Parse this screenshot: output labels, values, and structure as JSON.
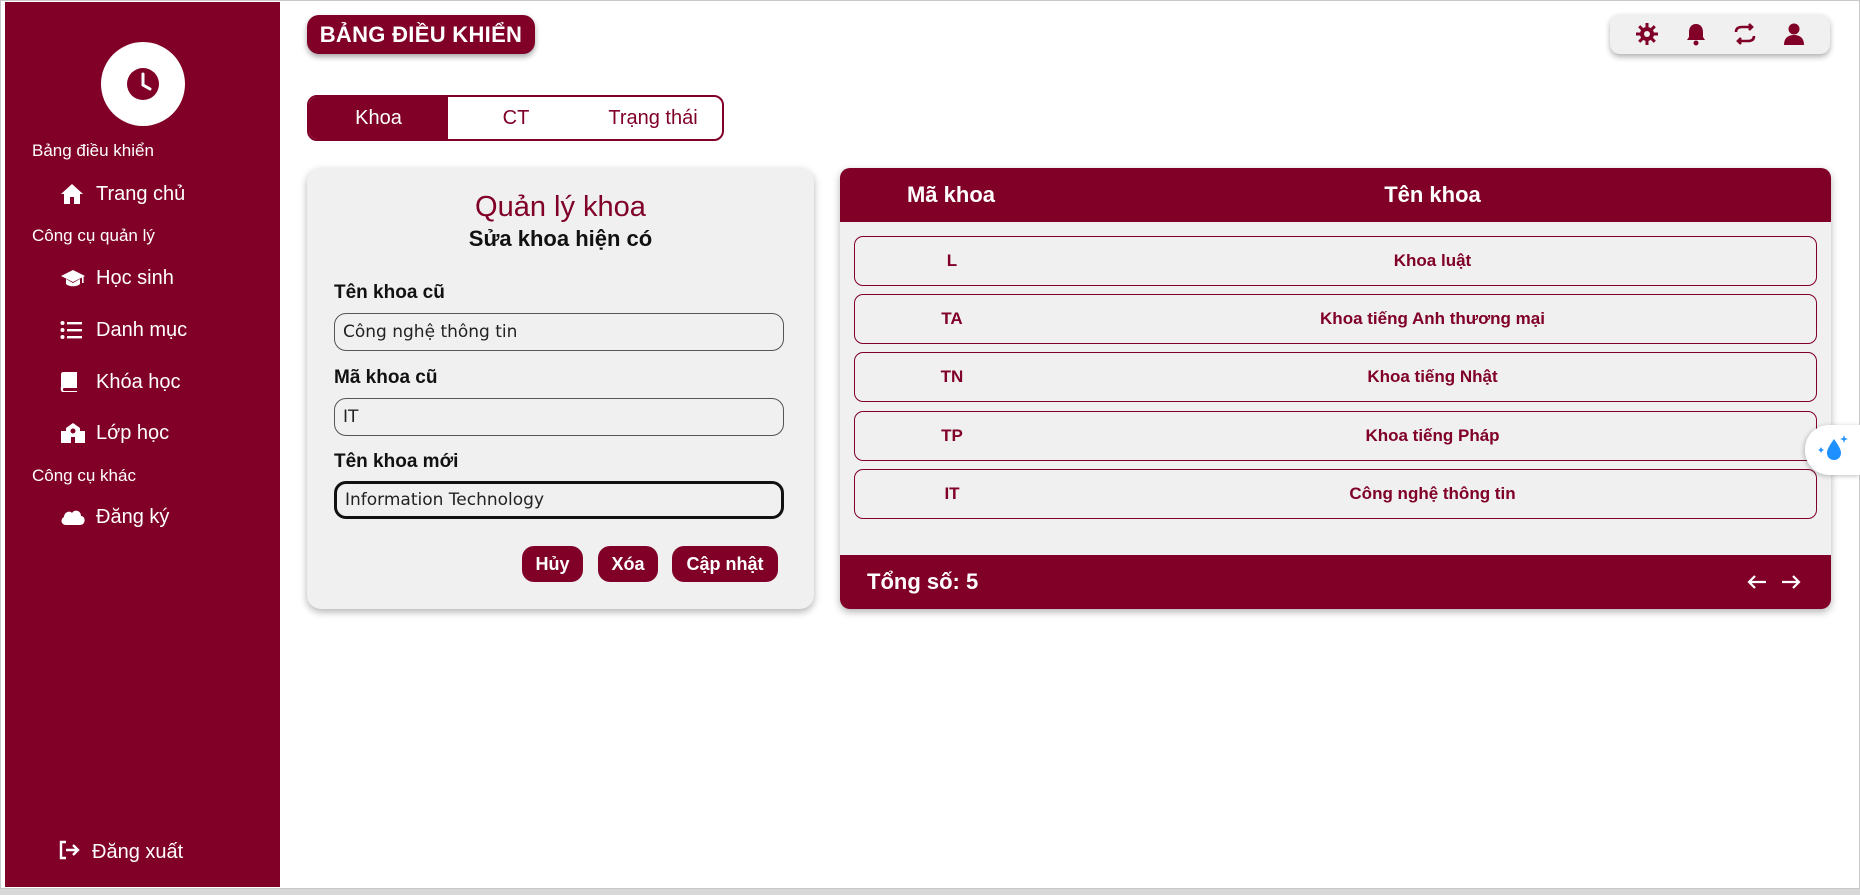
{
  "header": {
    "title": "BẢNG ĐIỀU KHIỂN"
  },
  "sidebar": {
    "sections": [
      "Bảng điều khiển",
      "Công cụ quản lý",
      "Công cụ khác"
    ],
    "items": [
      {
        "label": "Trang chủ",
        "icon": "home-icon"
      },
      {
        "label": "Học sinh",
        "icon": "graduation-cap-icon"
      },
      {
        "label": "Danh mục",
        "icon": "list-icon"
      },
      {
        "label": "Khóa học",
        "icon": "book-icon"
      },
      {
        "label": "Lớp học",
        "icon": "school-icon"
      },
      {
        "label": "Đăng ký",
        "icon": "cloud-icon"
      }
    ],
    "logout_label": "Đăng xuất"
  },
  "tabs": [
    {
      "label": "Khoa",
      "active": true
    },
    {
      "label": "CT",
      "active": false
    },
    {
      "label": "Trạng thái",
      "active": false
    }
  ],
  "form": {
    "title": "Quản lý khoa",
    "subtitle": "Sửa khoa hiện có",
    "old_name_label": "Tên khoa cũ",
    "old_name_value": "Công nghệ thông tin",
    "old_code_label": "Mã khoa cũ",
    "old_code_value": "IT",
    "new_name_label": "Tên khoa mới",
    "new_name_value": "Information Technology",
    "cancel_label": "Hủy",
    "delete_label": "Xóa",
    "update_label": "Cập nhật"
  },
  "table": {
    "columns": [
      "Mã khoa",
      "Tên khoa"
    ],
    "rows": [
      {
        "code": "L",
        "name": "Khoa luật"
      },
      {
        "code": "TA",
        "name": "Khoa tiếng Anh thương mại"
      },
      {
        "code": "TN",
        "name": "Khoa tiếng Nhật"
      },
      {
        "code": "TP",
        "name": "Khoa tiếng Pháp"
      },
      {
        "code": "IT",
        "name": "Công nghệ thông tin"
      }
    ],
    "total_label": "Tổng số: 5"
  },
  "colors": {
    "brand": "#800028",
    "panel": "#f0f0f0"
  }
}
